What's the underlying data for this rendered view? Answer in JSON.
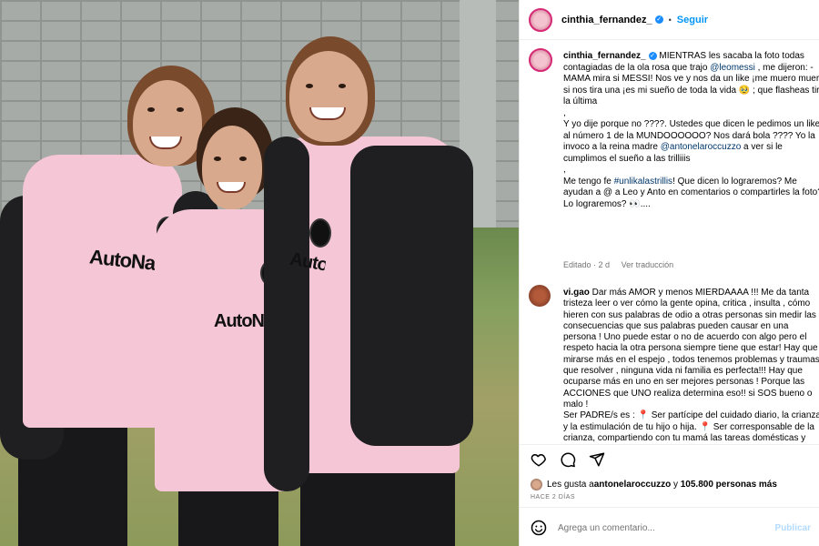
{
  "photo": {
    "sponsor_text": "AutoNation",
    "alt": "Tres niñas con uniformes rosas"
  },
  "post": {
    "username": "cinthia_fernandez_",
    "follow_label": "Seguir",
    "caption_username": "cinthia_fernandez_",
    "caption_lines": [
      "MIENTRAS les sacaba la foto todas contagiadas de la ola rosa que trajo ",
      "@leomessi",
      " , me dijeron: -MAMA mira si MESSI! Nos ve y nos da un like ¡me muero muerta si nos tira una ¡es mi sueño de toda la vida 🥹 ; que flasheas tiro la última\n,\nY yo dije porque no ????. Ustedes que dicen le pedimos un like al número 1 de la MUNDOOOOOO? Nos dará bola ???? Yo la invoco a la reina madre ",
      "@antonelaroccuzzo",
      " a ver si le cumplimos el sueño a las trilliiis\n,\nMe tengo fe ",
      "#unlikalastrillis",
      "! Que dicen lo lograremos? Me ayudan a @ a Leo y Anto en comentarios o compartirles la foto? Lo lograremos? 👀...."
    ],
    "edited_label": "Editado · 2 d",
    "translate_label": "Ver traducción"
  },
  "comment": {
    "username": "vi.gao",
    "text": " Dar más AMOR y menos MIERDAAAA !!! Me da tanta tristeza leer o ver cómo la gente opina, critica , insulta , cómo hieren con sus palabras de odio a otras personas sin medir las consecuencias que sus palabras pueden causar en una persona ! Uno puede estar o no de acuerdo con algo pero el respeto hacia la otra persona siempre tiene que estar! Hay que mirarse más en el espejo , todos tenemos problemas y traumas que resolver , ninguna vida ni familia es perfecta!!! Hay que ocuparse más en uno en ser mejores personas ! Porque las ACCIONES que UNO realiza determina eso!! si SOS bueno o malo !\nSer PADRE/s es : 📍 Ser partícipe del cuidado diario, la crianza y la estimulación de tu hijo o hija. 📍 Ser corresponsable de la crianza, compartiendo con tu mamá las tareas domésticas y cuidados, tales como: alimentar, vestir, pasear, hacer dormir, jugar, bañar y enseñar a tu hijo o hija. Cuando la relación se"
  },
  "footer": {
    "likes_prefix": "Les gusta a ",
    "likes_user": "antonelaroccuzzo",
    "likes_mid": " y ",
    "likes_count": "105.800 personas más",
    "posted_ago": "HACE 2 DÍAS",
    "comment_placeholder": "Agrega un comentario...",
    "publish_label": "Publicar"
  },
  "icons": [
    "heart-icon",
    "comment-icon",
    "share-icon",
    "emoji-icon",
    "verified-badge-icon"
  ],
  "colors": {
    "link": "#00376b",
    "follow": "#0095f6",
    "verified": "#1a8cff",
    "meta": "#737373"
  }
}
